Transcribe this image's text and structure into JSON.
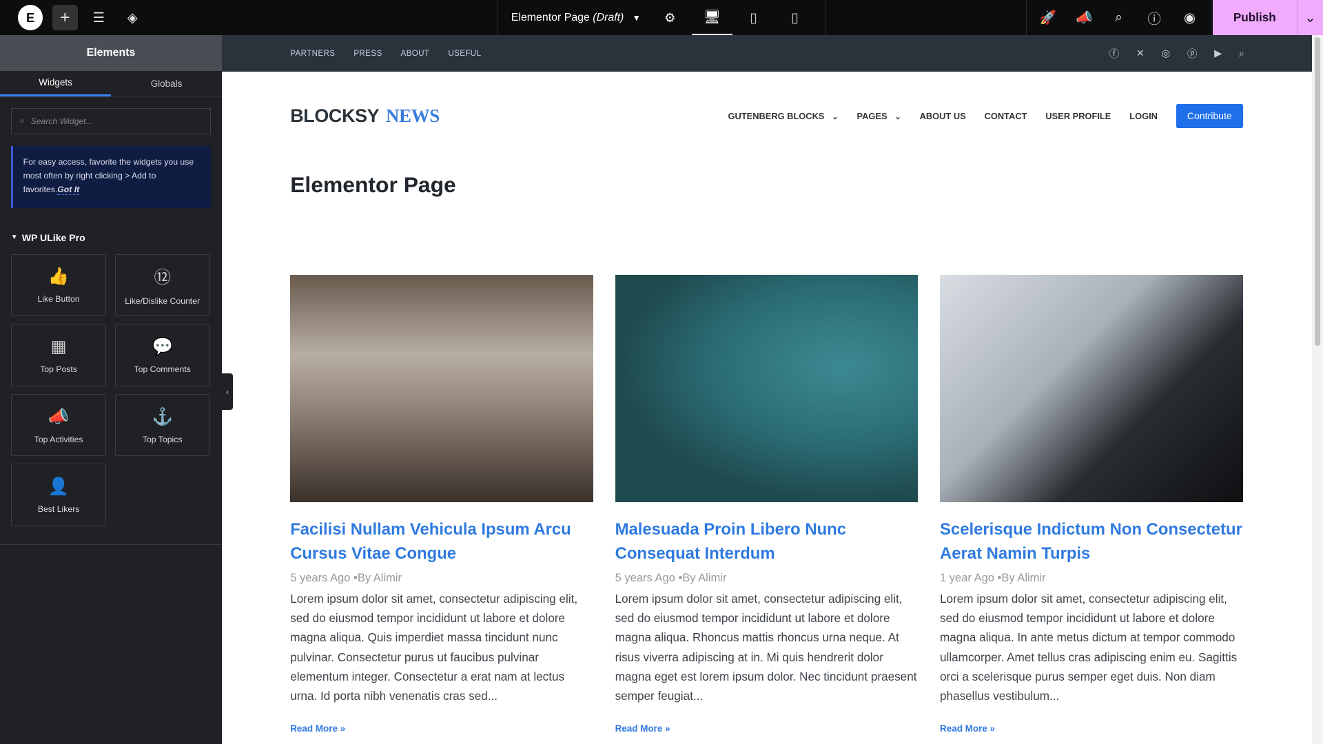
{
  "topbar": {
    "logo": "E",
    "add": "+",
    "title": "Elementor Page",
    "title_status": "(Draft)",
    "publish": "Publish",
    "icons": [
      "elementor-logo",
      "plus-icon",
      "sliders-icon",
      "layers-icon",
      "gear-icon",
      "desktop-icon",
      "tablet-icon",
      "mobile-icon",
      "rocket-icon",
      "megaphone-icon",
      "search-icon",
      "help-icon",
      "eye-icon",
      "chevron-down-icon"
    ],
    "accent": "#f0abfc"
  },
  "panel": {
    "header": "Elements",
    "tabs": [
      "Widgets",
      "Globals"
    ],
    "search_placeholder": "Search Widget...",
    "tip": "For easy access, favorite the widgets you use most often by right clicking > Add to favorites.",
    "tip_link": "Got It",
    "category": "WP ULike Pro",
    "widgets": [
      {
        "label": "Like Button",
        "icon": "👍"
      },
      {
        "label": "Like/Dislike Counter",
        "icon": "⑫"
      },
      {
        "label": "Top Posts",
        "icon": "▦"
      },
      {
        "label": "Top Comments",
        "icon": "💬"
      },
      {
        "label": "Top Activities",
        "icon": "📣"
      },
      {
        "label": "Top Topics",
        "icon": "⚓"
      },
      {
        "label": "Best Likers",
        "icon": "👤"
      }
    ]
  },
  "site": {
    "top_links": [
      "PARTNERS",
      "PRESS",
      "ABOUT",
      "USEFUL"
    ],
    "social": [
      "facebook-icon",
      "x-icon",
      "instagram-icon",
      "pinterest-icon",
      "youtube-icon",
      "search-icon"
    ],
    "brand_a": "BLOCKSY",
    "brand_b": "NEWS",
    "nav": [
      "GUTENBERG BLOCKS",
      "PAGES",
      "ABOUT US",
      "CONTACT",
      "USER PROFILE",
      "LOGIN"
    ],
    "contribute": "Contribute",
    "page_title": "Elementor Page",
    "posts": [
      {
        "title": "Facilisi Nullam Vehicula Ipsum Arcu Cursus Vitae Congue",
        "date": "5 years Ago",
        "author": "•By Alimir",
        "excerpt": "Lorem ipsum dolor sit amet, consectetur adipiscing elit, sed do eiusmod tempor incididunt ut labore et dolore magna aliqua. Quis imperdiet massa tincidunt nunc pulvinar. Consectetur purus ut faucibus pulvinar elementum integer. Consectetur a erat nam at lectus urna. Id porta nibh venenatis cras sed...",
        "read_more": "Read More »"
      },
      {
        "title": "Malesuada Proin Libero Nunc Consequat Interdum",
        "date": "5 years Ago",
        "author": "•By Alimir",
        "excerpt": "Lorem ipsum dolor sit amet, consectetur adipiscing elit, sed do eiusmod tempor incididunt ut labore et dolore magna aliqua. Rhoncus mattis rhoncus urna neque. At risus viverra adipiscing at in. Mi quis hendrerit dolor magna eget est lorem ipsum dolor. Nec tincidunt praesent semper feugiat...",
        "read_more": "Read More »"
      },
      {
        "title": "Scelerisque Indictum Non Consectetur Aerat Namin Turpis",
        "date": "1 year Ago",
        "author": "•By Alimir",
        "excerpt": "Lorem ipsum dolor sit amet, consectetur adipiscing elit, sed do eiusmod tempor incididunt ut labore et dolore magna aliqua. In ante metus dictum at tempor commodo ullamcorper. Amet tellus cras adipiscing enim eu. Sagittis orci a scelerisque purus semper eget duis. Non diam phasellus vestibulum...",
        "read_more": "Read More »"
      }
    ]
  }
}
